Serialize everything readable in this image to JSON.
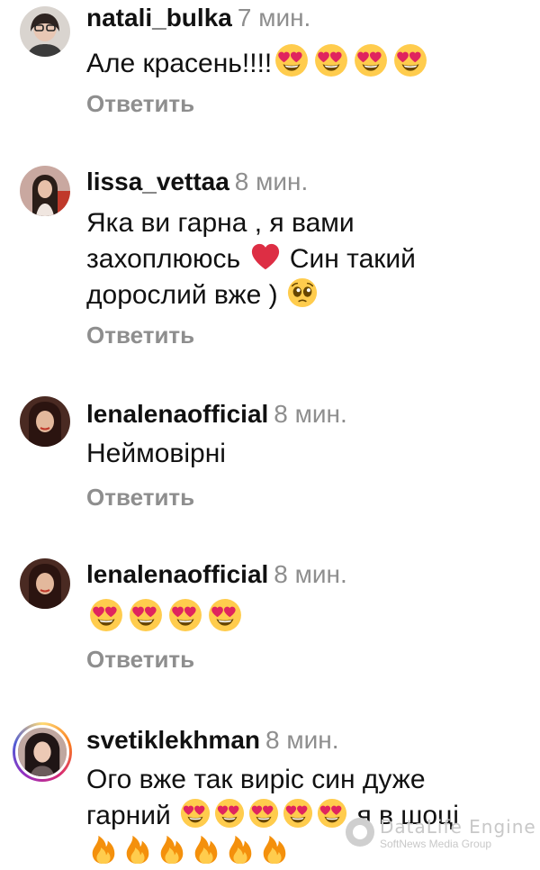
{
  "comments": [
    {
      "username": "natali_bulka",
      "time": "7 мин.",
      "text_before": "Але красень!!!!",
      "text_after": "",
      "reply_label": "Ответить"
    },
    {
      "username": "lissa_vettaa",
      "time": "8 мин.",
      "line1": "Яка ви гарна , я вами",
      "line2_before": "захоплююсь",
      "line2_after": " Син такий",
      "line3": "дорослий вже )",
      "reply_label": "Ответить"
    },
    {
      "username": "lenalenaofficial",
      "time": "8 мин.",
      "text": "Неймовірні",
      "reply_label": "Ответить"
    },
    {
      "username": "lenalenaofficial",
      "time": "8 мин.",
      "reply_label": "Ответить"
    },
    {
      "username": "svetiklekhman",
      "time": "8 мин.",
      "line1": "Ого вже так виріс син дуже",
      "line2_before": "гарний",
      "line2_after": "я в шоці"
    }
  ],
  "watermark": {
    "title": "DataLife Engine",
    "subtitle": "SoftNews Media Group"
  },
  "icons": {
    "heart_eyes": "heart-eyes-emoji",
    "red_heart": "red-heart-emoji",
    "pleading": "pleading-face-emoji",
    "fire": "fire-emoji"
  },
  "colors": {
    "text": "#111111",
    "muted": "#8e8e8e",
    "heart": "#e0245e"
  }
}
